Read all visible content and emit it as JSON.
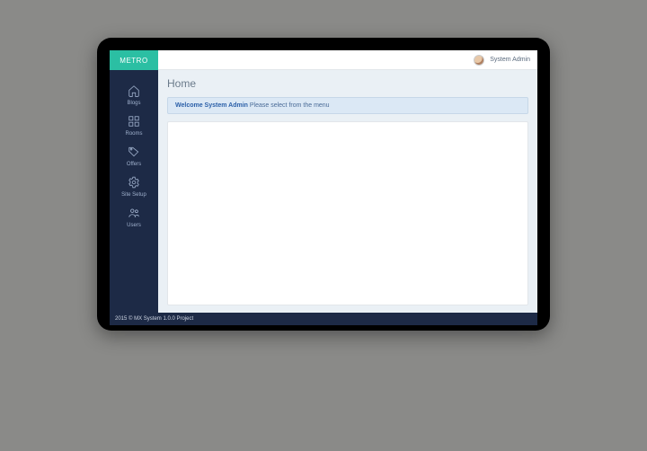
{
  "brand": {
    "name": "METRO"
  },
  "topbar": {
    "user_label": "System Admin"
  },
  "sidebar": {
    "items": [
      {
        "label": "Blogs",
        "icon": "home-icon"
      },
      {
        "label": "Rooms",
        "icon": "grid-icon"
      },
      {
        "label": "Offers",
        "icon": "tag-icon"
      },
      {
        "label": "Site Setup",
        "icon": "gear-icon"
      },
      {
        "label": "Users",
        "icon": "users-icon"
      }
    ]
  },
  "page": {
    "title": "Home",
    "welcome_strong": "Welcome System Admin",
    "welcome_rest": " Please select from the menu"
  },
  "footer": {
    "text": "2015 © MX System 1.0.0 Project"
  }
}
